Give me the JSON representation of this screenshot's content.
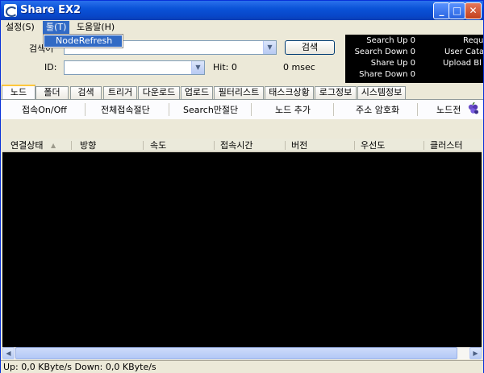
{
  "window": {
    "title": "Share EX2"
  },
  "menus": {
    "settings": "설정(S)",
    "tools": "툴(T)",
    "help": "도움말(H)"
  },
  "dropdown": {
    "node_refresh": "NodeRefresh"
  },
  "search_form": {
    "search_label": "검색어",
    "search_value": "",
    "id_label": "ID:",
    "id_value": "",
    "hit": "Hit: 0",
    "time": "0 msec",
    "search_button": "검색"
  },
  "stats": {
    "search_up": "Search Up  0",
    "search_down": "Search Down  0",
    "share_up": "Share Up  0",
    "share_down": "Share Down  0",
    "req": "Requ",
    "user_cat": "User Cata",
    "upload_bl": "Upload Bl"
  },
  "tabs": [
    "노드",
    "폴더",
    "검색",
    "트리거",
    "다운로드",
    "업로드",
    "필터리스트",
    "태스크상황",
    "로그정보",
    "시스템정보"
  ],
  "toolbar": {
    "connect_toggle": "접속On/Off",
    "disconnect_all": "전체접속절단",
    "search_only_cut": "Search만절단",
    "add_node": "노드 추가",
    "encrypt_addr": "주소 암호화",
    "node_more": "노드전"
  },
  "columns": [
    "연결상태",
    "방향",
    "속도",
    "접속시간",
    "버전",
    "우선도",
    "클러스터"
  ],
  "status": {
    "text": "Up: 0,0 KByte/s Down: 0,0 KByte/s"
  },
  "colors": {
    "title_bar": "#0a53d8",
    "selection": "#316ac5",
    "grid": "#000000"
  }
}
